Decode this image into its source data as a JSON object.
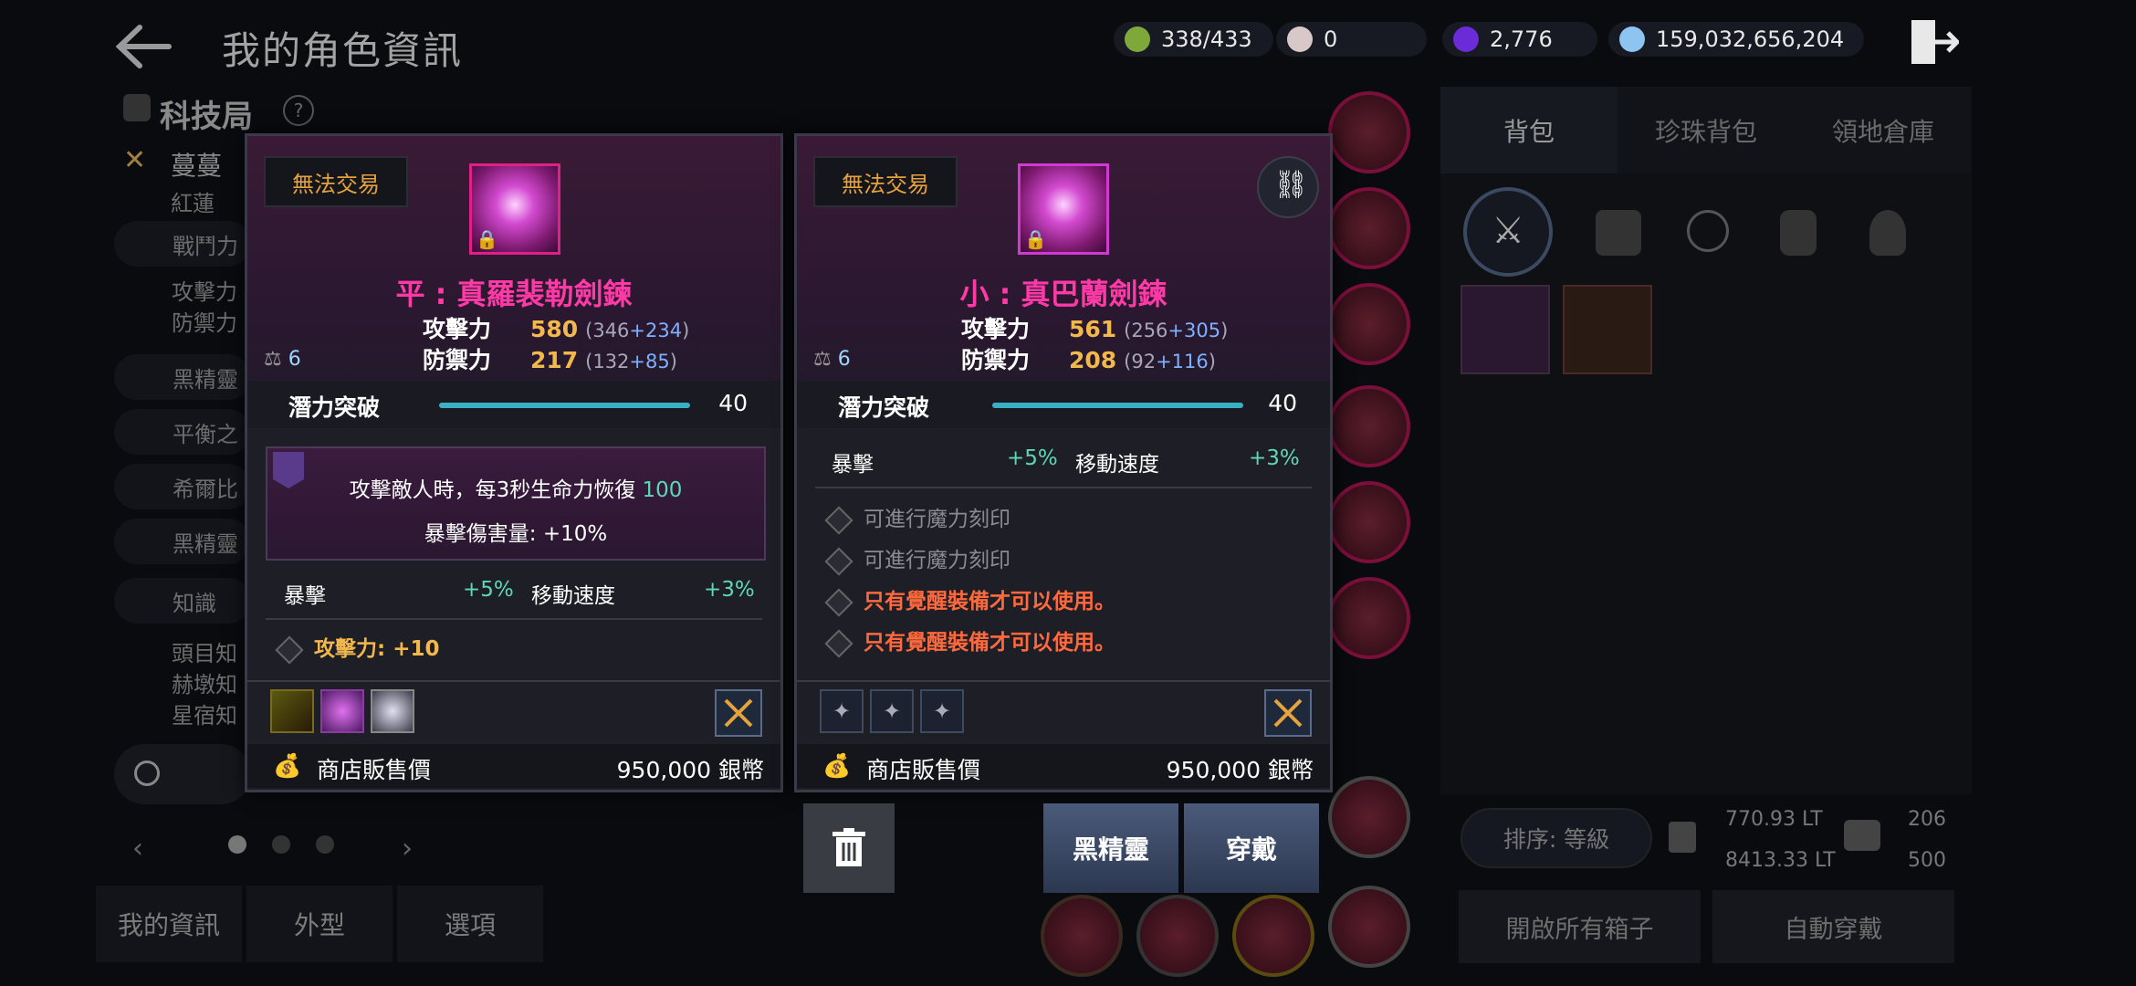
{
  "header": {
    "title": "我的角色資訊"
  },
  "currencies": [
    {
      "icon": "green-gem-icon",
      "value": "338/433",
      "color": "#8fbf3a"
    },
    {
      "icon": "pearl-icon",
      "value": "0",
      "color": "#d9c8c8"
    },
    {
      "icon": "purple-orb-icon",
      "value": "2,776",
      "color": "#6b2bd6"
    },
    {
      "icon": "silver-coin-icon",
      "value": "159,032,656,204",
      "color": "#8ec4f0"
    }
  ],
  "left_panel": {
    "heading": "科技局",
    "char_name": "蔓蔓",
    "char_sub": "紅蓮",
    "rows": [
      "戰鬥力",
      "攻擊力",
      "防禦力",
      "黑精靈",
      "平衡之",
      "希爾比",
      "黑精靈",
      "知識",
      "頭目知",
      "赫墩知",
      "星宿知"
    ],
    "bottom_tabs": [
      "我的資訊",
      "外型",
      "選項"
    ]
  },
  "right_panel": {
    "tabs": [
      "背包",
      "珍珠背包",
      "領地倉庫"
    ],
    "sort_label": "排序: 等級",
    "weight_1": "770.93 LT",
    "weight_2": "8413.33 LT",
    "slots_used": "206",
    "slots_total": "500",
    "open_all": "開啟所有箱子",
    "auto_equip": "自動穿戴"
  },
  "card_left": {
    "trade": "無法交易",
    "name": "平 : 真羅裴勒劍鍊",
    "atk_label": "攻擊力",
    "atk_value": "580",
    "atk_base": "(346",
    "atk_plus": "+234",
    "atk_close": ")",
    "def_label": "防禦力",
    "def_value": "217",
    "def_base": "(132",
    "def_plus": "+85",
    "def_close": ")",
    "weight": "6",
    "potential_label": "潛力突破",
    "potential_value": "40",
    "potential_fill": 1.0,
    "effect_line1": "攻擊敵人時，每3秒生命力恢復",
    "effect_line1_num": "100",
    "effect_line2": "暴擊傷害量: +10%",
    "crit_label": "暴擊",
    "crit_value": "+5%",
    "speed_label": "移動速度",
    "speed_value": "+3%",
    "bonus_label": "攻擊力: +10",
    "price_label": "商店販售價",
    "price_value": "950,000 銀幣"
  },
  "card_right": {
    "trade": "無法交易",
    "name": "小 : 真巴蘭劍鍊",
    "atk_label": "攻擊力",
    "atk_value": "561",
    "atk_base": "(256",
    "atk_plus": "+305",
    "atk_close": ")",
    "def_label": "防禦力",
    "def_value": "208",
    "def_base": "(92",
    "def_plus": "+116",
    "def_close": ")",
    "weight": "6",
    "potential_label": "潛力突破",
    "potential_value": "40",
    "potential_fill": 1.0,
    "crit_label": "暴擊",
    "crit_value": "+5%",
    "speed_label": "移動速度",
    "speed_value": "+3%",
    "options": [
      "可進行魔力刻印",
      "可進行魔力刻印",
      "只有覺醒裝備才可以使用。",
      "只有覺醒裝備才可以使用。"
    ],
    "price_label": "商店販售價",
    "price_value": "950,000 銀幣",
    "btn_spirit": "黑精靈",
    "btn_equip": "穿戴"
  },
  "colors": {
    "name_pink": "#ff3aa6",
    "gold": "#f2b84c",
    "teal": "#5fd7b5",
    "orange": "#e6a23c",
    "red_opt": "#ff6a3d"
  }
}
